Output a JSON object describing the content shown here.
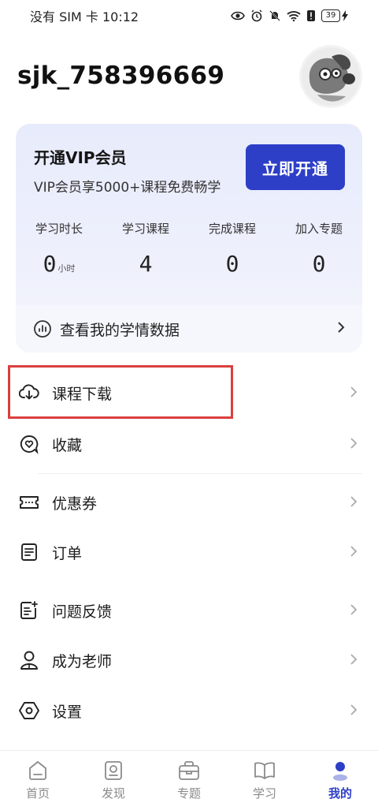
{
  "status_bar": {
    "left_text": "没有 SIM 卡",
    "time": "10:12",
    "battery": "39"
  },
  "profile": {
    "username": "sjk_758396669"
  },
  "vip": {
    "title": "开通VIP会员",
    "subtitle": "VIP会员享5000+课程免费畅学",
    "button": "立即开通",
    "stats": [
      {
        "label": "学习时长",
        "value": "0",
        "unit": "小时"
      },
      {
        "label": "学习课程",
        "value": "4",
        "unit": ""
      },
      {
        "label": "完成课程",
        "value": "0",
        "unit": ""
      },
      {
        "label": "加入专题",
        "value": "0",
        "unit": ""
      }
    ],
    "data_link": "查看我的学情数据"
  },
  "menu": [
    {
      "label": "课程下载",
      "icon": "cloud-download-icon"
    },
    {
      "label": "收藏",
      "icon": "heart-chat-icon"
    },
    {
      "label": "优惠券",
      "icon": "ticket-icon"
    },
    {
      "label": "订单",
      "icon": "document-icon"
    },
    {
      "label": "问题反馈",
      "icon": "feedback-icon"
    },
    {
      "label": "成为老师",
      "icon": "person-icon"
    },
    {
      "label": "设置",
      "icon": "hexagon-settings-icon"
    }
  ],
  "nav": [
    {
      "label": "首页",
      "icon": "home-icon"
    },
    {
      "label": "发现",
      "icon": "discover-icon"
    },
    {
      "label": "专题",
      "icon": "briefcase-icon"
    },
    {
      "label": "学习",
      "icon": "book-icon"
    },
    {
      "label": "我的",
      "icon": "user-icon"
    }
  ],
  "colors": {
    "accent": "#2d3fc7",
    "highlight_border": "#d9403e",
    "card_bg": "#e9ecfb"
  }
}
